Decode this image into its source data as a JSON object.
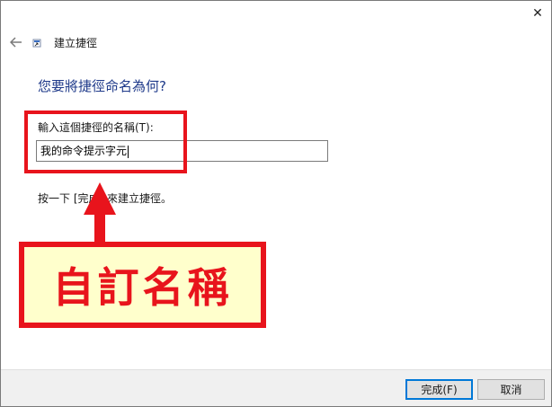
{
  "window": {
    "close_label": "✕"
  },
  "wizard": {
    "title": "建立捷徑",
    "icon": "shortcut-icon"
  },
  "content": {
    "heading": "您要將捷徑命名為何?",
    "field_label": "輸入這個捷徑的名稱(T):",
    "field_value": "我的命令提示字元",
    "instruction": "按一下 [完成] 來建立捷徑。"
  },
  "annotation": {
    "callout_text": "自訂名稱",
    "color": "#e8141c",
    "fill": "#ffffcc"
  },
  "buttons": {
    "finish": "完成(F)",
    "cancel": "取消"
  },
  "colors": {
    "heading": "#1f3a8a",
    "default_button_border": "#0078d7"
  }
}
